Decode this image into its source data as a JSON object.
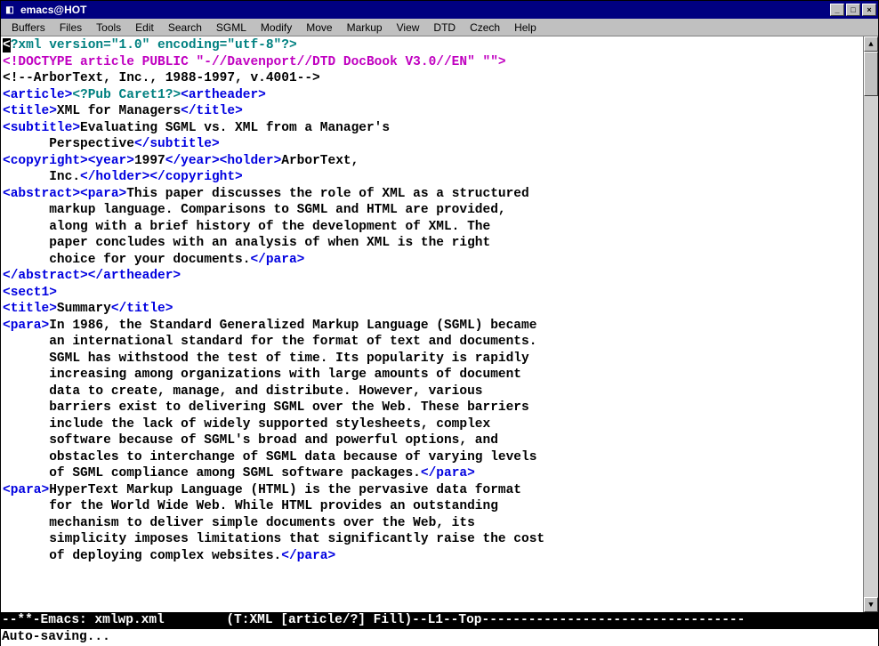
{
  "window": {
    "title": "emacs@HOT"
  },
  "menu": [
    "Buffers",
    "Files",
    "Tools",
    "Edit",
    "Search",
    "SGML",
    "Modify",
    "Move",
    "Markup",
    "View",
    "DTD",
    "Czech",
    "Help"
  ],
  "lines": [
    [
      {
        "cls": "cursor",
        "t": "<"
      },
      {
        "cls": "teal",
        "t": "?xml version=\"1.0\" encoding=\"utf-8\"?>"
      }
    ],
    [
      {
        "cls": "magenta",
        "t": "<!DOCTYPE article PUBLIC \"-//Davenport//DTD DocBook V3.0//EN\" \"\">"
      }
    ],
    [
      {
        "cls": "black",
        "t": "<!--ArborText, Inc., 1988-1997, v.4001-->"
      }
    ],
    [
      {
        "cls": "blue",
        "t": "<article>"
      },
      {
        "cls": "teal",
        "t": "<?Pub Caret1?>"
      },
      {
        "cls": "blue",
        "t": "<artheader>"
      }
    ],
    [
      {
        "cls": "blue",
        "t": "<title>"
      },
      {
        "cls": "black",
        "t": "XML for Managers"
      },
      {
        "cls": "blue",
        "t": "</title>"
      }
    ],
    [
      {
        "cls": "blue",
        "t": "<subtitle>"
      },
      {
        "cls": "black",
        "t": "Evaluating SGML vs. XML from a Manager's"
      }
    ],
    [
      {
        "cls": "black",
        "t": "      Perspective"
      },
      {
        "cls": "blue",
        "t": "</subtitle>"
      }
    ],
    [
      {
        "cls": "blue",
        "t": "<copyright><year>"
      },
      {
        "cls": "black",
        "t": "1997"
      },
      {
        "cls": "blue",
        "t": "</year><holder>"
      },
      {
        "cls": "black",
        "t": "ArborText,"
      }
    ],
    [
      {
        "cls": "black",
        "t": "      Inc."
      },
      {
        "cls": "blue",
        "t": "</holder></copyright>"
      }
    ],
    [
      {
        "cls": "blue",
        "t": "<abstract><para>"
      },
      {
        "cls": "black",
        "t": "This paper discusses the role of XML as a structured"
      }
    ],
    [
      {
        "cls": "black",
        "t": "      markup language. Comparisons to SGML and HTML are provided,"
      }
    ],
    [
      {
        "cls": "black",
        "t": "      along with a brief history of the development of XML. The"
      }
    ],
    [
      {
        "cls": "black",
        "t": "      paper concludes with an analysis of when XML is the right"
      }
    ],
    [
      {
        "cls": "black",
        "t": "      choice for your documents."
      },
      {
        "cls": "blue",
        "t": "</para>"
      }
    ],
    [
      {
        "cls": "blue",
        "t": "</abstract></artheader>"
      }
    ],
    [
      {
        "cls": "blue",
        "t": "<sect1>"
      }
    ],
    [
      {
        "cls": "blue",
        "t": "<title>"
      },
      {
        "cls": "black",
        "t": "Summary"
      },
      {
        "cls": "blue",
        "t": "</title>"
      }
    ],
    [
      {
        "cls": "blue",
        "t": "<para>"
      },
      {
        "cls": "black",
        "t": "In 1986, the Standard Generalized Markup Language (SGML) became"
      }
    ],
    [
      {
        "cls": "black",
        "t": "      an international standard for the format of text and documents."
      }
    ],
    [
      {
        "cls": "black",
        "t": "      SGML has withstood the test of time. Its popularity is rapidly"
      }
    ],
    [
      {
        "cls": "black",
        "t": "      increasing among organizations with large amounts of document"
      }
    ],
    [
      {
        "cls": "black",
        "t": "      data to create, manage, and distribute. However, various"
      }
    ],
    [
      {
        "cls": "black",
        "t": "      barriers exist to delivering SGML over the Web. These barriers"
      }
    ],
    [
      {
        "cls": "black",
        "t": "      include the lack of widely supported stylesheets, complex"
      }
    ],
    [
      {
        "cls": "black",
        "t": "      software because of SGML's broad and powerful options, and"
      }
    ],
    [
      {
        "cls": "black",
        "t": "      obstacles to interchange of SGML data because of varying levels"
      }
    ],
    [
      {
        "cls": "black",
        "t": "      of SGML compliance among SGML software packages."
      },
      {
        "cls": "blue",
        "t": "</para>"
      }
    ],
    [
      {
        "cls": "blue",
        "t": "<para>"
      },
      {
        "cls": "black",
        "t": "HyperText Markup Language (HTML) is the pervasive data format"
      }
    ],
    [
      {
        "cls": "black",
        "t": "      for the World Wide Web. While HTML provides an outstanding"
      }
    ],
    [
      {
        "cls": "black",
        "t": "      mechanism to deliver simple documents over the Web, its"
      }
    ],
    [
      {
        "cls": "black",
        "t": "      simplicity imposes limitations that significantly raise the cost"
      }
    ],
    [
      {
        "cls": "black",
        "t": "      of deploying complex websites."
      },
      {
        "cls": "blue",
        "t": "</para>"
      }
    ]
  ],
  "modeline": "--**-Emacs: xmlwp.xml        (T:XML [article/?] Fill)--L1--Top----------------------------------",
  "echo": "Auto-saving..."
}
